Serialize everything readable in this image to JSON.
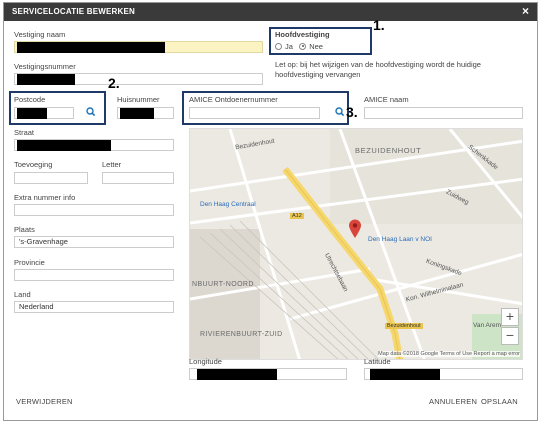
{
  "dialog": {
    "title": "SERVICELOCATIE BEWERKEN",
    "close_glyph": "×"
  },
  "fields": {
    "vestiging_naam": "Vestiging naam",
    "vestigingsnummer": "Vestigingsnummer",
    "postcode": "Postcode",
    "huisnummer": "Huisnummer",
    "straat": "Straat",
    "toevoeging": "Toevoeging",
    "letter": "Letter",
    "extra_nummer_info": "Extra nummer info",
    "plaats": "Plaats",
    "plaats_value": "'s-Gravenhage",
    "provincie": "Provincie",
    "land": "Land",
    "land_value": "Nederland",
    "amice_ontdoenernummer": "AMICE Ontdoenernummer",
    "amice_naam": "AMICE naam",
    "longitude": "Longitude",
    "latitude": "Latitude"
  },
  "hoofdvestiging": {
    "label": "Hoofdvestiging",
    "option_ja": "Ja",
    "option_nee": "Nee",
    "selected": "Nee",
    "note": "Let op: bij het wijzigen van de hoofdvestiging wordt de huidige hoofdvestiging vervangen"
  },
  "annotations": {
    "a1": "1.",
    "a2": "2.",
    "a3": "3."
  },
  "map": {
    "labels": {
      "bezuidenhout_upper": "BEZUIDENHOUT",
      "bezuidenhout_street": "Bezuidenhout",
      "schenkkade": "Schenkkade",
      "den_haag_centraal": "Den Haag Centraal",
      "den_haag_laan": "Den Haag Laan v NOI",
      "a12": "A12",
      "utrechtsebaan": "Utrechtsebaan",
      "nbuurt_noord": "NBUURT-NOORD",
      "rivierenbuurt_zuid": "RIVIERENBUURT-ZUID",
      "koningskade": "Koningskade",
      "kon_wilhelminalaan": "Kon. Wilhelminalaan",
      "bezuidenhout_badge": "Bezuidenhout",
      "van_arem": "Van Arem",
      "zuidweg": "Zuidweg"
    },
    "zoom_in": "+",
    "zoom_out": "−",
    "footer": "Map data ©2018 Google   Terms of Use   Report a map error"
  },
  "actions": {
    "delete": "VERWIJDEREN",
    "cancel": "ANNULEREN",
    "save": "OPSLAAN"
  },
  "colors": {
    "accent": "#1a73b8",
    "title_bg": "#3a3a3a",
    "highlight_input": "#fbf3c2",
    "annotation_box": "#1f3a68",
    "map_pin": "#d9453b",
    "road_yellow": "#f5d76e"
  }
}
